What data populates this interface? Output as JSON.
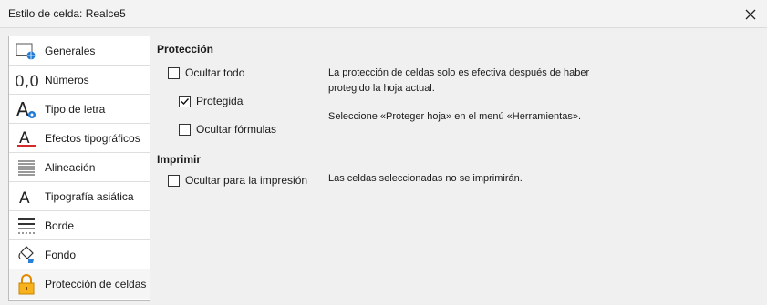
{
  "window": {
    "title": "Estilo de celda: Realce5"
  },
  "sidebar": {
    "items": [
      {
        "label": "Generales",
        "icon": "organizer-icon"
      },
      {
        "label": "Números",
        "icon": "number-format-icon"
      },
      {
        "label": "Tipo de letra",
        "icon": "font-icon"
      },
      {
        "label": "Efectos tipográficos",
        "icon": "font-effects-icon"
      },
      {
        "label": "Alineación",
        "icon": "alignment-icon"
      },
      {
        "label": "Tipografía asiática",
        "icon": "asian-typography-icon"
      },
      {
        "label": "Borde",
        "icon": "borders-icon"
      },
      {
        "label": "Fondo",
        "icon": "background-fill-icon"
      },
      {
        "label": "Protección de celdas",
        "icon": "padlock-icon"
      }
    ],
    "selected_index": 8
  },
  "protection": {
    "title": "Protección",
    "hide_all": {
      "label": "Ocultar todo",
      "checked": false
    },
    "protected": {
      "label": "Protegida",
      "checked": true
    },
    "hide_formula": {
      "label": "Ocultar fórmulas",
      "checked": false
    },
    "note1": "La protección de celdas solo es efectiva después de haber protegido la hoja actual.",
    "note2": "Seleccione «Proteger hoja» en el menú «Herramientas»."
  },
  "print": {
    "title": "Imprimir",
    "hide_printing": {
      "label": "Ocultar para la impresión",
      "checked": false
    },
    "note": "Las celdas seleccionadas no se imprimirán."
  }
}
